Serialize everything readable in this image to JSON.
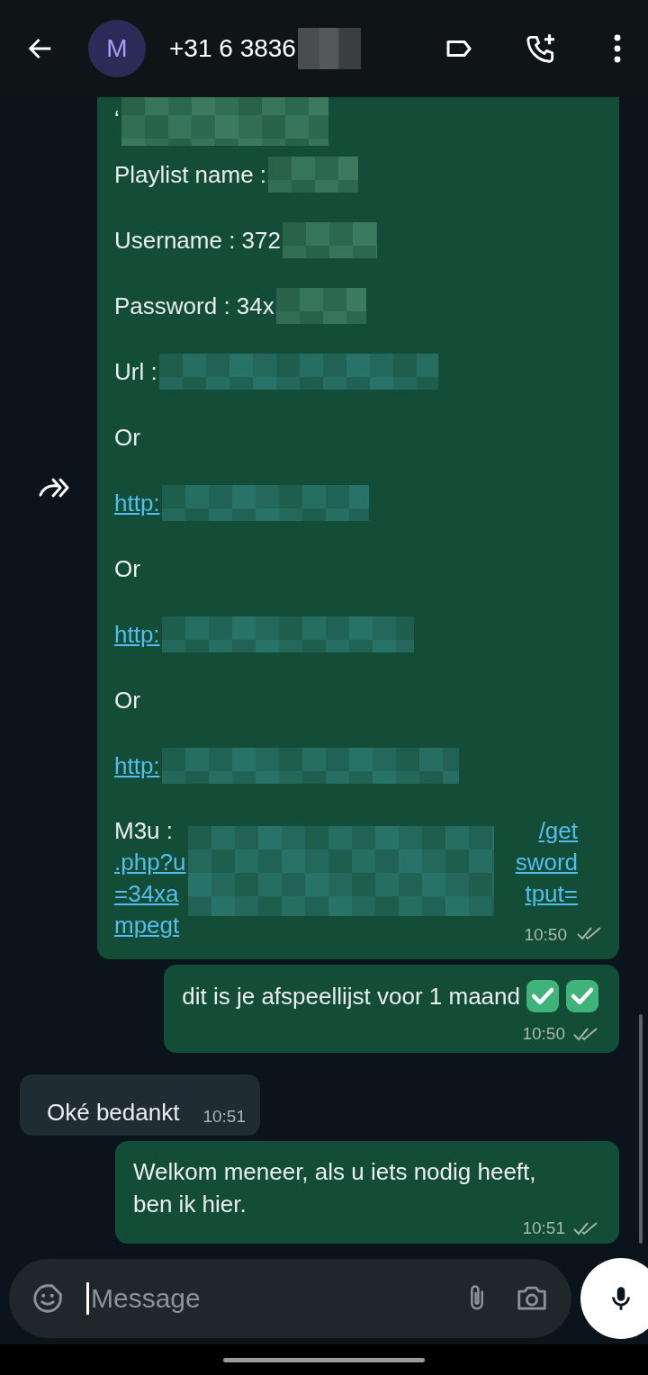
{
  "header": {
    "avatar_letter": "M",
    "title": "+31 6 3836",
    "title_redacted": true
  },
  "messages": [
    {
      "incoming": false,
      "forwarded": true,
      "time": "10:50",
      "read": false,
      "lines": [
        {
          "kind": "text",
          "text": "‘",
          "redacted": true
        },
        {
          "kind": "text",
          "text": "Playlist name :",
          "redacted": true
        },
        {
          "kind": "text",
          "text": "Username : 372",
          "redacted": true
        },
        {
          "kind": "text",
          "text": "Password : 34x",
          "redacted": true
        },
        {
          "kind": "text",
          "text": "Url :",
          "redacted": true
        },
        {
          "kind": "text",
          "text": "Or",
          "redacted": false
        },
        {
          "kind": "link",
          "text": "http:",
          "redacted": true
        },
        {
          "kind": "text",
          "text": "Or",
          "redacted": false
        },
        {
          "kind": "link",
          "text": "http:",
          "redacted": true
        },
        {
          "kind": "text",
          "text": "Or",
          "redacted": false
        },
        {
          "kind": "link",
          "text": "http:",
          "redacted": true
        },
        {
          "kind": "m3u",
          "label": "M3u :",
          "rows": [
            {
              "end": "/get"
            },
            {
              "start": ".php?u",
              "end": "sword"
            },
            {
              "start": "=34xa",
              "end": "tput="
            },
            {
              "start": "mpegt"
            }
          ],
          "redacted": true
        }
      ]
    },
    {
      "incoming": false,
      "forwarded": false,
      "time": "10:50",
      "read": false,
      "text": "dit is je afspeellijst voor 1 maand",
      "emojis": [
        {
          "kind": "check"
        },
        {
          "kind": "check"
        }
      ]
    },
    {
      "incoming": true,
      "forwarded": false,
      "time": "10:51",
      "text": "Oké bedankt"
    },
    {
      "incoming": false,
      "forwarded": false,
      "time": "10:51",
      "read": false,
      "text": "Welkom meneer, als u iets nodig heeft, ben ik hier."
    }
  ],
  "composer": {
    "placeholder": "Message"
  }
}
